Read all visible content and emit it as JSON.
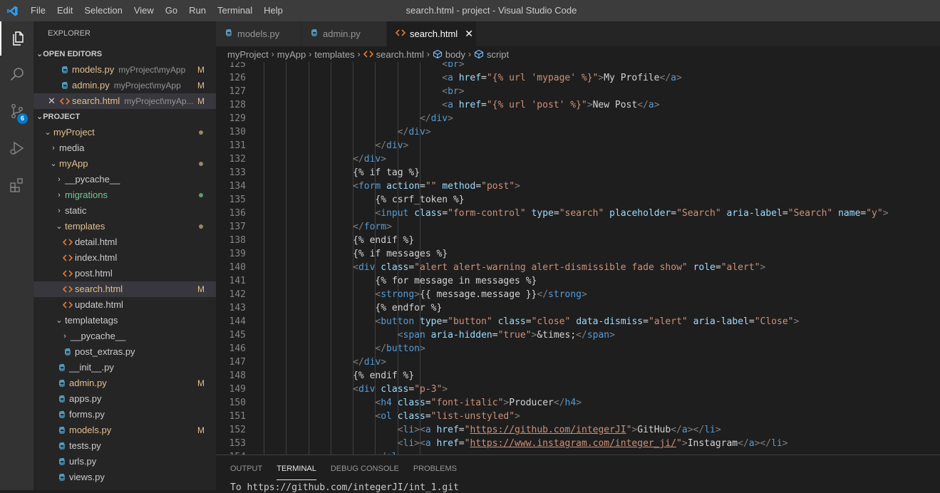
{
  "window": {
    "title": "search.html - project - Visual Studio Code",
    "menu": [
      "File",
      "Edit",
      "Selection",
      "View",
      "Go",
      "Run",
      "Terminal",
      "Help"
    ]
  },
  "activity": {
    "scm_badge": "6"
  },
  "colors": {
    "accent": "#007acc",
    "modified": "#e2c08d",
    "untracked": "#73c991",
    "html_icon": "#e37933",
    "python_icon": "#519aba"
  },
  "explorer": {
    "title": "EXPLORER",
    "open_editors_label": "OPEN EDITORS",
    "open_editors": [
      {
        "name": "models.py",
        "path": "myProject\\myApp",
        "badge": "M"
      },
      {
        "name": "admin.py",
        "path": "myProject\\myApp",
        "badge": "M"
      },
      {
        "name": "search.html",
        "path": "myProject\\myAp...",
        "badge": "M"
      }
    ],
    "project_label": "PROJECT",
    "tree": {
      "myProject": "myProject",
      "media": "media",
      "myApp": "myApp",
      "pycache": "__pycache__",
      "migrations": "migrations",
      "static": "static",
      "templates": "templates",
      "detail": "detail.html",
      "index": "index.html",
      "post": "post.html",
      "search": "search.html",
      "search_badge": "M",
      "update": "update.html",
      "templatetags": "templatetags",
      "pycache2": "__pycache__",
      "post_extras": "post_extras.py",
      "init": "__init__.py",
      "admin": "admin.py",
      "admin_badge": "M",
      "apps": "apps.py",
      "forms": "forms.py",
      "models": "models.py",
      "models_badge": "M",
      "tests": "tests.py",
      "urls": "urls.py",
      "views": "views.py"
    }
  },
  "tabs": [
    {
      "label": "models.py"
    },
    {
      "label": "admin.py"
    },
    {
      "label": "search.html"
    }
  ],
  "breadcrumb": [
    "myProject",
    "myApp",
    "templates",
    "search.html",
    "body",
    "script"
  ],
  "editor": {
    "lines": [
      {
        "n": "125",
        "indent": 32,
        "tokens": [
          [
            "t",
            "<"
          ],
          [
            "g",
            "br"
          ],
          [
            "t",
            ">"
          ]
        ]
      },
      {
        "n": "126",
        "indent": 32,
        "tokens": [
          [
            "t",
            "<"
          ],
          [
            "g",
            "a"
          ],
          [
            "x",
            " "
          ],
          [
            "a",
            "href"
          ],
          [
            "x",
            "="
          ],
          [
            "s",
            "\"{% url 'mypage' %}\""
          ],
          [
            "t",
            ">"
          ],
          [
            "x",
            "My Profile"
          ],
          [
            "t",
            "</"
          ],
          [
            "g",
            "a"
          ],
          [
            "t",
            ">"
          ]
        ]
      },
      {
        "n": "127",
        "indent": 32,
        "tokens": [
          [
            "t",
            "<"
          ],
          [
            "g",
            "br"
          ],
          [
            "t",
            ">"
          ]
        ]
      },
      {
        "n": "128",
        "indent": 32,
        "tokens": [
          [
            "t",
            "<"
          ],
          [
            "g",
            "a"
          ],
          [
            "x",
            " "
          ],
          [
            "a",
            "href"
          ],
          [
            "x",
            "="
          ],
          [
            "s",
            "\"{% url 'post' %}\""
          ],
          [
            "t",
            ">"
          ],
          [
            "x",
            "New Post"
          ],
          [
            "t",
            "</"
          ],
          [
            "g",
            "a"
          ],
          [
            "t",
            ">"
          ]
        ]
      },
      {
        "n": "129",
        "indent": 28,
        "tokens": [
          [
            "t",
            "</"
          ],
          [
            "g",
            "div"
          ],
          [
            "t",
            ">"
          ]
        ]
      },
      {
        "n": "130",
        "indent": 24,
        "tokens": [
          [
            "t",
            "</"
          ],
          [
            "g",
            "div"
          ],
          [
            "t",
            ">"
          ]
        ]
      },
      {
        "n": "131",
        "indent": 20,
        "tokens": [
          [
            "t",
            "</"
          ],
          [
            "g",
            "div"
          ],
          [
            "t",
            ">"
          ]
        ]
      },
      {
        "n": "132",
        "indent": 16,
        "tokens": [
          [
            "t",
            "</"
          ],
          [
            "g",
            "div"
          ],
          [
            "t",
            ">"
          ]
        ]
      },
      {
        "n": "133",
        "indent": 16,
        "tokens": [
          [
            "x",
            "{% if tag %}"
          ]
        ]
      },
      {
        "n": "134",
        "indent": 16,
        "tokens": [
          [
            "t",
            "<"
          ],
          [
            "g",
            "form"
          ],
          [
            "x",
            " "
          ],
          [
            "a",
            "action"
          ],
          [
            "x",
            "="
          ],
          [
            "s",
            "\"\""
          ],
          [
            "x",
            " "
          ],
          [
            "a",
            "method"
          ],
          [
            "x",
            "="
          ],
          [
            "s",
            "\"post\""
          ],
          [
            "t",
            ">"
          ]
        ]
      },
      {
        "n": "135",
        "indent": 20,
        "tokens": [
          [
            "x",
            "{% csrf_token %}"
          ]
        ]
      },
      {
        "n": "136",
        "indent": 20,
        "tokens": [
          [
            "t",
            "<"
          ],
          [
            "g",
            "input"
          ],
          [
            "x",
            " "
          ],
          [
            "a",
            "class"
          ],
          [
            "x",
            "="
          ],
          [
            "s",
            "\"form-control\""
          ],
          [
            "x",
            " "
          ],
          [
            "a",
            "type"
          ],
          [
            "x",
            "="
          ],
          [
            "s",
            "\"search\""
          ],
          [
            "x",
            " "
          ],
          [
            "a",
            "placeholder"
          ],
          [
            "x",
            "="
          ],
          [
            "s",
            "\"Search\""
          ],
          [
            "x",
            " "
          ],
          [
            "a",
            "aria-label"
          ],
          [
            "x",
            "="
          ],
          [
            "s",
            "\"Search\""
          ],
          [
            "x",
            " "
          ],
          [
            "a",
            "name"
          ],
          [
            "x",
            "="
          ],
          [
            "s",
            "\"y\""
          ],
          [
            "t",
            ">"
          ]
        ]
      },
      {
        "n": "137",
        "indent": 16,
        "tokens": [
          [
            "t",
            "</"
          ],
          [
            "g",
            "form"
          ],
          [
            "t",
            ">"
          ]
        ]
      },
      {
        "n": "138",
        "indent": 16,
        "tokens": [
          [
            "x",
            "{% endif %}"
          ]
        ]
      },
      {
        "n": "139",
        "indent": 16,
        "tokens": [
          [
            "x",
            "{% if messages %}"
          ]
        ]
      },
      {
        "n": "140",
        "indent": 16,
        "tokens": [
          [
            "t",
            "<"
          ],
          [
            "g",
            "div"
          ],
          [
            "x",
            " "
          ],
          [
            "a",
            "class"
          ],
          [
            "x",
            "="
          ],
          [
            "s",
            "\"alert alert-warning alert-dismissible fade show\""
          ],
          [
            "x",
            " "
          ],
          [
            "a",
            "role"
          ],
          [
            "x",
            "="
          ],
          [
            "s",
            "\"alert\""
          ],
          [
            "t",
            ">"
          ]
        ]
      },
      {
        "n": "141",
        "indent": 20,
        "tokens": [
          [
            "x",
            "{% for message in messages %}"
          ]
        ]
      },
      {
        "n": "142",
        "indent": 20,
        "tokens": [
          [
            "t",
            "<"
          ],
          [
            "g",
            "strong"
          ],
          [
            "t",
            ">"
          ],
          [
            "x",
            "{{ message.message }}"
          ],
          [
            "t",
            "</"
          ],
          [
            "g",
            "strong"
          ],
          [
            "t",
            ">"
          ]
        ]
      },
      {
        "n": "143",
        "indent": 20,
        "tokens": [
          [
            "x",
            "{% endfor %}"
          ]
        ]
      },
      {
        "n": "144",
        "indent": 20,
        "tokens": [
          [
            "t",
            "<"
          ],
          [
            "g",
            "button"
          ],
          [
            "x",
            " "
          ],
          [
            "a",
            "type"
          ],
          [
            "x",
            "="
          ],
          [
            "s",
            "\"button\""
          ],
          [
            "x",
            " "
          ],
          [
            "a",
            "class"
          ],
          [
            "x",
            "="
          ],
          [
            "s",
            "\"close\""
          ],
          [
            "x",
            " "
          ],
          [
            "a",
            "data-dismiss"
          ],
          [
            "x",
            "="
          ],
          [
            "s",
            "\"alert\""
          ],
          [
            "x",
            " "
          ],
          [
            "a",
            "aria-label"
          ],
          [
            "x",
            "="
          ],
          [
            "s",
            "\"Close\""
          ],
          [
            "t",
            ">"
          ]
        ]
      },
      {
        "n": "145",
        "indent": 24,
        "tokens": [
          [
            "t",
            "<"
          ],
          [
            "g",
            "span"
          ],
          [
            "x",
            " "
          ],
          [
            "a",
            "aria-hidden"
          ],
          [
            "x",
            "="
          ],
          [
            "s",
            "\"true\""
          ],
          [
            "t",
            ">"
          ],
          [
            "x",
            "&times;"
          ],
          [
            "t",
            "</"
          ],
          [
            "g",
            "span"
          ],
          [
            "t",
            ">"
          ]
        ]
      },
      {
        "n": "146",
        "indent": 20,
        "tokens": [
          [
            "t",
            "</"
          ],
          [
            "g",
            "button"
          ],
          [
            "t",
            ">"
          ]
        ]
      },
      {
        "n": "147",
        "indent": 16,
        "tokens": [
          [
            "t",
            "</"
          ],
          [
            "g",
            "div"
          ],
          [
            "t",
            ">"
          ]
        ]
      },
      {
        "n": "148",
        "indent": 16,
        "tokens": [
          [
            "x",
            "{% endif %}"
          ]
        ]
      },
      {
        "n": "149",
        "indent": 16,
        "tokens": [
          [
            "t",
            "<"
          ],
          [
            "g",
            "div"
          ],
          [
            "x",
            " "
          ],
          [
            "a",
            "class"
          ],
          [
            "x",
            "="
          ],
          [
            "s",
            "\"p-3\""
          ],
          [
            "t",
            ">"
          ]
        ]
      },
      {
        "n": "150",
        "indent": 20,
        "tokens": [
          [
            "t",
            "<"
          ],
          [
            "g",
            "h4"
          ],
          [
            "x",
            " "
          ],
          [
            "a",
            "class"
          ],
          [
            "x",
            "="
          ],
          [
            "s",
            "\"font-italic\""
          ],
          [
            "t",
            ">"
          ],
          [
            "x",
            "Producer"
          ],
          [
            "t",
            "</"
          ],
          [
            "g",
            "h4"
          ],
          [
            "t",
            ">"
          ]
        ]
      },
      {
        "n": "151",
        "indent": 20,
        "tokens": [
          [
            "t",
            "<"
          ],
          [
            "g",
            "ol"
          ],
          [
            "x",
            " "
          ],
          [
            "a",
            "class"
          ],
          [
            "x",
            "="
          ],
          [
            "s",
            "\"list-unstyled\""
          ],
          [
            "t",
            ">"
          ]
        ]
      },
      {
        "n": "152",
        "indent": 24,
        "tokens": [
          [
            "t",
            "<"
          ],
          [
            "g",
            "li"
          ],
          [
            "t",
            "><"
          ],
          [
            "g",
            "a"
          ],
          [
            "x",
            " "
          ],
          [
            "a",
            "href"
          ],
          [
            "x",
            "="
          ],
          [
            "s",
            "\""
          ],
          [
            "u",
            "https://github.com/integerJI"
          ],
          [
            "s",
            "\""
          ],
          [
            "t",
            ">"
          ],
          [
            "x",
            "GitHub"
          ],
          [
            "t",
            "</"
          ],
          [
            "g",
            "a"
          ],
          [
            "t",
            "></"
          ],
          [
            "g",
            "li"
          ],
          [
            "t",
            ">"
          ]
        ]
      },
      {
        "n": "153",
        "indent": 24,
        "tokens": [
          [
            "t",
            "<"
          ],
          [
            "g",
            "li"
          ],
          [
            "t",
            "><"
          ],
          [
            "g",
            "a"
          ],
          [
            "x",
            " "
          ],
          [
            "a",
            "href"
          ],
          [
            "x",
            "="
          ],
          [
            "s",
            "\""
          ],
          [
            "u",
            "https://www.instagram.com/integer_ji/"
          ],
          [
            "s",
            "\""
          ],
          [
            "t",
            ">"
          ],
          [
            "x",
            "Instagram"
          ],
          [
            "t",
            "</"
          ],
          [
            "g",
            "a"
          ],
          [
            "t",
            "></"
          ],
          [
            "g",
            "li"
          ],
          [
            "t",
            ">"
          ]
        ]
      },
      {
        "n": "154",
        "indent": 20,
        "tokens": [
          [
            "t",
            "</"
          ],
          [
            "g",
            "ol"
          ],
          [
            "t",
            ">"
          ]
        ]
      }
    ]
  },
  "panel": {
    "tabs": [
      "OUTPUT",
      "TERMINAL",
      "DEBUG CONSOLE",
      "PROBLEMS"
    ],
    "active_tab": "TERMINAL",
    "terminal_line": "To https://github.com/integerJI/int_1.git"
  }
}
